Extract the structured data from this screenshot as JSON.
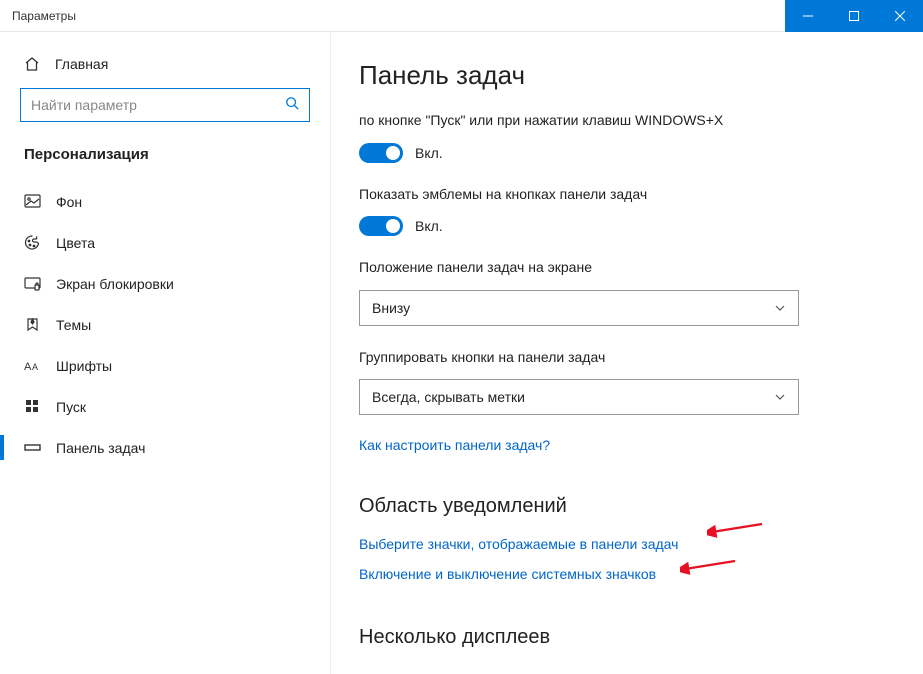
{
  "window": {
    "title": "Параметры"
  },
  "sidebar": {
    "home_label": "Главная",
    "search_placeholder": "Найти параметр",
    "category": "Персонализация",
    "items": [
      {
        "icon": "picture-icon",
        "label": "Фон"
      },
      {
        "icon": "palette-icon",
        "label": "Цвета"
      },
      {
        "icon": "lockscreen-icon",
        "label": "Экран блокировки"
      },
      {
        "icon": "themes-icon",
        "label": "Темы"
      },
      {
        "icon": "fonts-icon",
        "label": "Шрифты"
      },
      {
        "icon": "start-icon",
        "label": "Пуск"
      },
      {
        "icon": "taskbar-icon",
        "label": "Панель задач"
      }
    ]
  },
  "content": {
    "title": "Панель задач",
    "setting1_label": "по кнопке \"Пуск\" или при нажатии клавиш WINDOWS+X",
    "toggle_on": "Вкл.",
    "setting2_label": "Показать эмблемы на кнопках панели задач",
    "position_label": "Положение панели задач на экране",
    "position_value": "Внизу",
    "group_label": "Группировать кнопки на панели задач",
    "group_value": "Всегда, скрывать метки",
    "help_link": "Как настроить панели задач?",
    "notif_title": "Область уведомлений",
    "notif_link1": "Выберите значки, отображаемые в панели задач",
    "notif_link2": "Включение и выключение системных значков",
    "multidisplay_title": "Несколько дисплеев"
  }
}
